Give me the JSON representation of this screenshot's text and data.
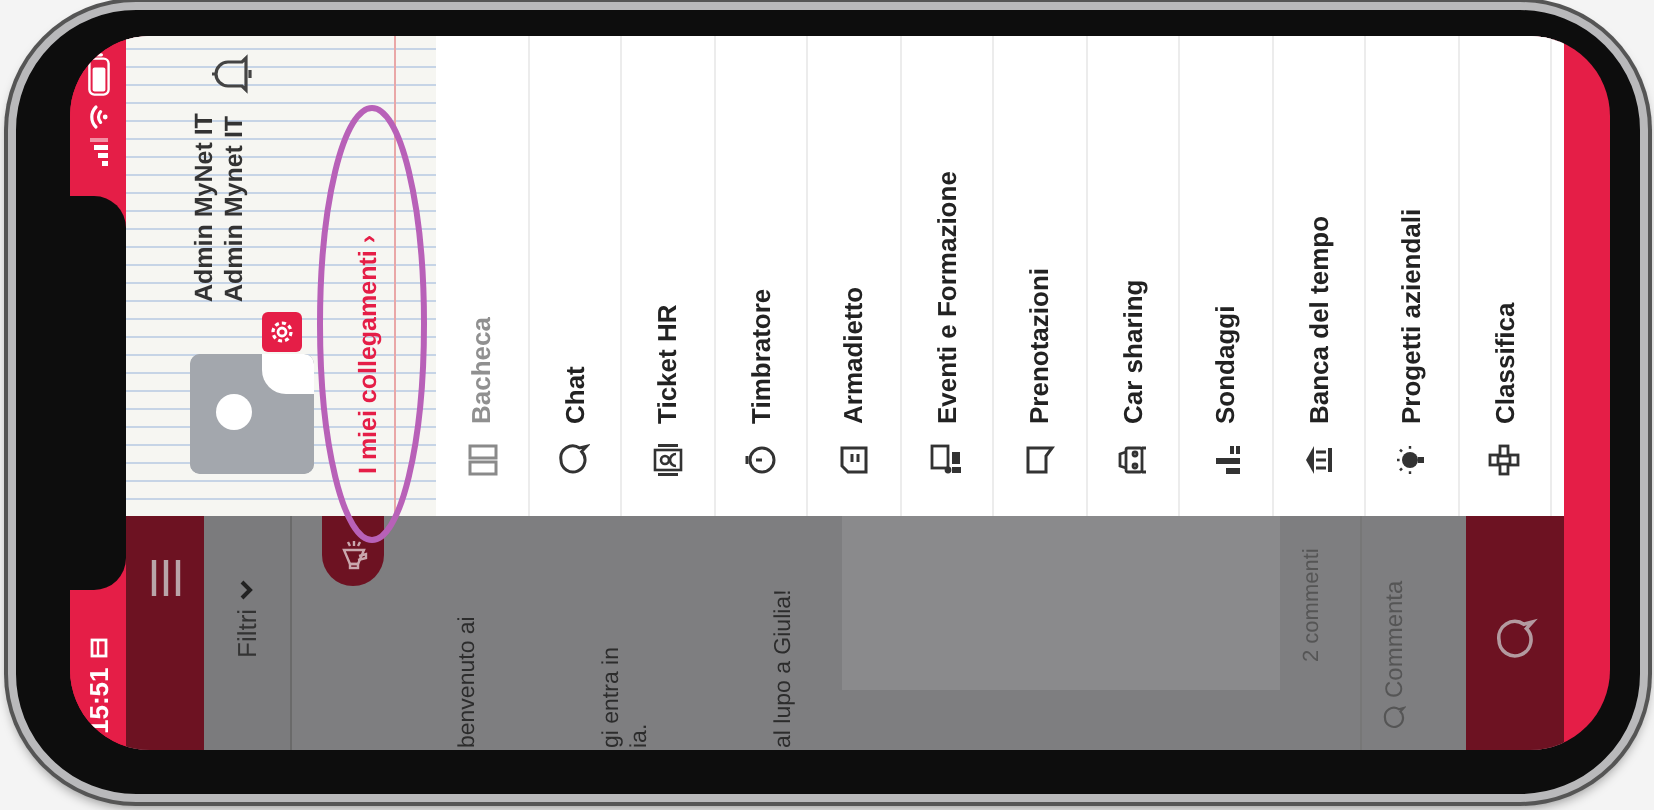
{
  "status_bar": {
    "time": "15:51"
  },
  "app": {
    "filter": "Filtri",
    "feed": [
      {
        "text": "benvenuto ai"
      },
      {
        "text": "gi entra in\nia."
      },
      {
        "text": "al lupo a Giulia!"
      }
    ],
    "comments": "2 commenti",
    "comment_action": "Commenta"
  },
  "drawer": {
    "user": {
      "name": "Admin MyNet IT",
      "username": "Admin Mynet IT"
    },
    "link": "I miei collegamenti ›",
    "menu": [
      {
        "label": "Bacheca",
        "selected": true
      },
      {
        "label": "Chat",
        "selected": false
      },
      {
        "label": "Ticket HR",
        "selected": false
      },
      {
        "label": "Timbratore",
        "selected": false
      },
      {
        "label": "Armadietto",
        "selected": false
      },
      {
        "label": "Eventi e Formazione",
        "selected": false
      },
      {
        "label": "Prenotazioni",
        "selected": false
      },
      {
        "label": "Car sharing",
        "selected": false
      },
      {
        "label": "Sondaggi",
        "selected": false
      },
      {
        "label": "Banca del tempo",
        "selected": false
      },
      {
        "label": "Progetti aziendali",
        "selected": false
      },
      {
        "label": "Classifica",
        "selected": false
      }
    ]
  }
}
